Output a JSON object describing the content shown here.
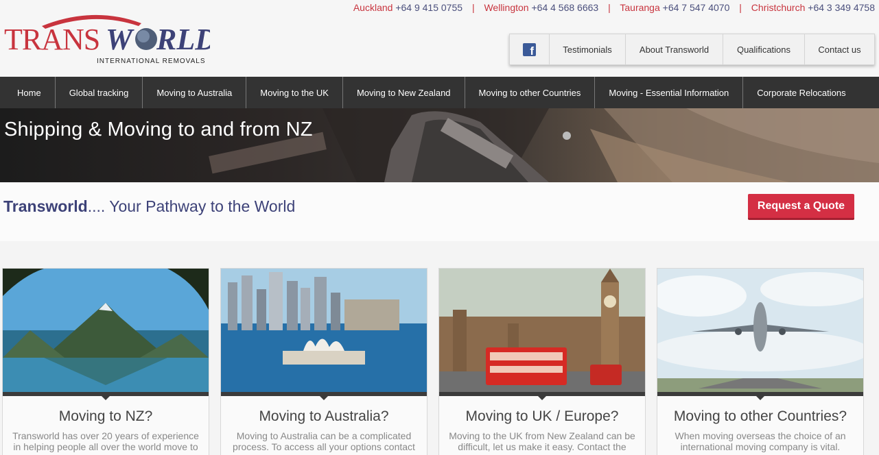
{
  "logo": {
    "brand": "TRANSWORLD",
    "sub": "INTERNATIONAL REMOVALS"
  },
  "phones": [
    {
      "city": "Auckland",
      "number": "+64 9 415 0755"
    },
    {
      "city": "Wellington",
      "number": "+64 4 568 6663"
    },
    {
      "city": "Tauranga",
      "number": "+64 7 547 4070"
    },
    {
      "city": "Christchurch",
      "number": "+64 3 349 4758"
    }
  ],
  "utility_nav": {
    "facebook_icon": "facebook-icon",
    "items": [
      "Testimonials",
      "About Transworld",
      "Qualifications",
      "Contact us"
    ]
  },
  "main_nav": [
    "Home",
    "Global tracking",
    "Moving to Australia",
    "Moving to the UK",
    "Moving to New Zealand",
    "Moving to other Countries",
    "Moving - Essential Information",
    "Corporate Relocations"
  ],
  "banner": {
    "title": "Shipping & Moving to and from NZ"
  },
  "tagline": {
    "brand": "Transworld",
    "rest": ".... Your Pathway to the World"
  },
  "quote_button": "Request a Quote",
  "cards": [
    {
      "title": "Moving to NZ?",
      "text": "Transworld has over 20 years of experience in helping people all over the world move to"
    },
    {
      "title": "Moving to Australia?",
      "text": "Moving to Australia can be a complicated process. To access all your options contact"
    },
    {
      "title": "Moving to UK / Europe?",
      "text": "Moving to the UK from New Zealand can be difficult, let us make it easy. Contact the"
    },
    {
      "title": "Moving to other Countries?",
      "text": "When moving overseas the choice of an international moving company is vital."
    }
  ],
  "colors": {
    "accent_red": "#d42f44",
    "brand_navy": "#3d4278",
    "nav_bg": "#333333",
    "facebook_blue": "#3b5a98"
  }
}
